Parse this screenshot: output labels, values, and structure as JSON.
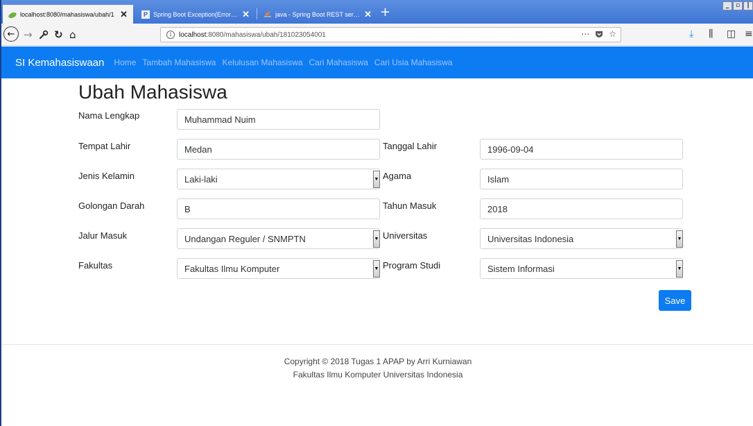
{
  "browser": {
    "tabs": [
      {
        "label": "localhost:8080/mahasiswa/ubah/1",
        "active": true,
        "favicon": "leaf-icon"
      },
      {
        "label": "Spring Boot Exception(Error) Hand",
        "active": false,
        "favicon": "P"
      },
      {
        "label": "java - Spring Boot REST service ex",
        "active": false,
        "favicon": "stackoverflow-icon"
      }
    ],
    "url_host": "localhost",
    "url_rest": ":8080/mahasiswa/ubah/181023054001"
  },
  "nav": {
    "brand": "SI Kemahasiswaan",
    "links": [
      "Home",
      "Tambah Mahasiswa",
      "Kelulusan Mahasiswa",
      "Cari Mahasiswa",
      "Cari Usia Mahasiswa"
    ]
  },
  "form": {
    "title": "Ubah Mahasiswa",
    "nama_label": "Nama Lengkap",
    "nama_value": "Muhammad Nuim",
    "tempat_label": "Tempat Lahir",
    "tempat_value": "Medan",
    "tanggal_label": "Tanggal Lahir",
    "tanggal_value": "1996-09-04",
    "jk_label": "Jenis Kelamin",
    "jk_value": "Laki-laki",
    "agama_label": "Agama",
    "agama_value": "Islam",
    "gol_label": "Golongan Darah",
    "gol_value": "B",
    "tahun_label": "Tahun Masuk",
    "tahun_value": "2018",
    "jalur_label": "Jalur Masuk",
    "jalur_value": "Undangan Reguler / SNMPTN",
    "univ_label": "Universitas",
    "univ_value": "Universitas Indonesia",
    "fak_label": "Fakultas",
    "fak_value": "Fakultas Ilmu Komputer",
    "prodi_label": "Program Studi",
    "prodi_value": "Sistem Informasi",
    "save_label": "Save"
  },
  "footer": {
    "line1": "Copyright © 2018 Tugas 1 APAP by Arri Kurniawan",
    "line2": "Fakultas Ilmu Komputer Universitas Indonesia"
  },
  "colors": {
    "primary": "#0d7cf2",
    "tabbar": "#3f75d6"
  }
}
